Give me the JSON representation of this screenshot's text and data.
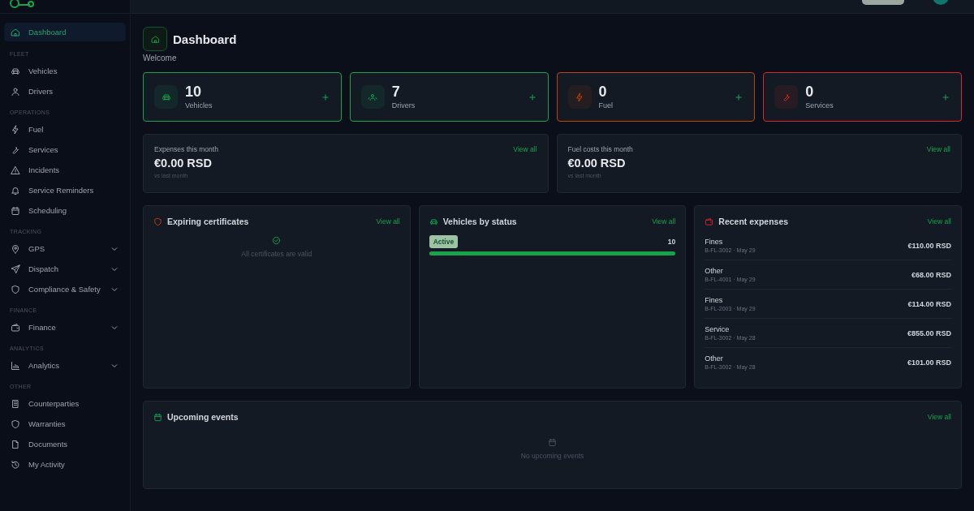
{
  "sidebar": {
    "items": [
      {
        "kind": "item",
        "label": "Dashboard",
        "selected": true
      },
      {
        "kind": "section",
        "label": "FLEET"
      },
      {
        "kind": "item",
        "label": "Vehicles",
        "selected": false
      },
      {
        "kind": "item",
        "label": "Drivers",
        "selected": false
      },
      {
        "kind": "section",
        "label": "OPERATIONS"
      },
      {
        "kind": "item",
        "label": "Fuel",
        "selected": false
      },
      {
        "kind": "item",
        "label": "Services",
        "selected": false
      },
      {
        "kind": "item",
        "label": "Incidents",
        "selected": false
      },
      {
        "kind": "item",
        "label": "Service Reminders",
        "selected": false
      },
      {
        "kind": "item",
        "label": "Scheduling",
        "selected": false
      },
      {
        "kind": "section",
        "label": "TRACKING"
      },
      {
        "kind": "group",
        "label": "GPS",
        "expanded": false
      },
      {
        "kind": "group",
        "label": "Dispatch",
        "expanded": false
      },
      {
        "kind": "group",
        "label": "Compliance & Safety",
        "expanded": false
      },
      {
        "kind": "section",
        "label": "FINANCE"
      },
      {
        "kind": "group",
        "label": "Finance",
        "expanded": false
      },
      {
        "kind": "section",
        "label": "ANALYTICS"
      },
      {
        "kind": "group",
        "label": "Analytics",
        "expanded": false
      },
      {
        "kind": "section",
        "label": "OTHER"
      },
      {
        "kind": "item",
        "label": "Counterparties",
        "selected": false
      },
      {
        "kind": "item",
        "label": "Warranties",
        "selected": false
      },
      {
        "kind": "item",
        "label": "Documents",
        "selected": false
      },
      {
        "kind": "item",
        "label": "My Activity",
        "selected": false
      }
    ]
  },
  "page": {
    "title": "Dashboard",
    "subtitle": "Welcome"
  },
  "stats": [
    {
      "value": "10",
      "label": "Vehicles",
      "color": "#16a34a"
    },
    {
      "value": "7",
      "label": "Drivers",
      "color": "#16a34a"
    },
    {
      "value": "0",
      "label": "Fuel",
      "color": "#c2410c"
    },
    {
      "value": "0",
      "label": "Services",
      "color": "#dc2626"
    }
  ],
  "summaries": [
    {
      "title": "Expenses this month",
      "link": "View all",
      "amount": "€0.00 RSD",
      "note": "vs last month"
    },
    {
      "title": "Fuel costs this month",
      "link": "View all",
      "amount": "€0.00 RSD",
      "note": "vs last month"
    }
  ],
  "certificates": {
    "title": "Expiring certificates",
    "link": "View all",
    "empty": "All certificates are valid"
  },
  "vehicle_status": {
    "title": "Vehicles by status",
    "link": "View all",
    "rows": [
      {
        "status": "Active",
        "count": "10",
        "level": 1
      }
    ]
  },
  "recent_expenses": {
    "title": "Recent expenses",
    "link": "View all",
    "rows": [
      {
        "category": "Fines",
        "meta": "B-FL-3002 · May 29",
        "amount": "€110.00 RSD"
      },
      {
        "category": "Other",
        "meta": "B-FL-4001 · May 29",
        "amount": "€68.00 RSD"
      },
      {
        "category": "Fines",
        "meta": "B-FL-2003 · May 29",
        "amount": "€114.00 RSD"
      },
      {
        "category": "Service",
        "meta": "B-FL-3002 · May 28",
        "amount": "€855.00 RSD"
      },
      {
        "category": "Other",
        "meta": "B-FL-3002 · May 28",
        "amount": "€101.00 RSD"
      }
    ]
  },
  "events": {
    "title": "Upcoming events",
    "link": "View all",
    "empty": "No upcoming events"
  }
}
